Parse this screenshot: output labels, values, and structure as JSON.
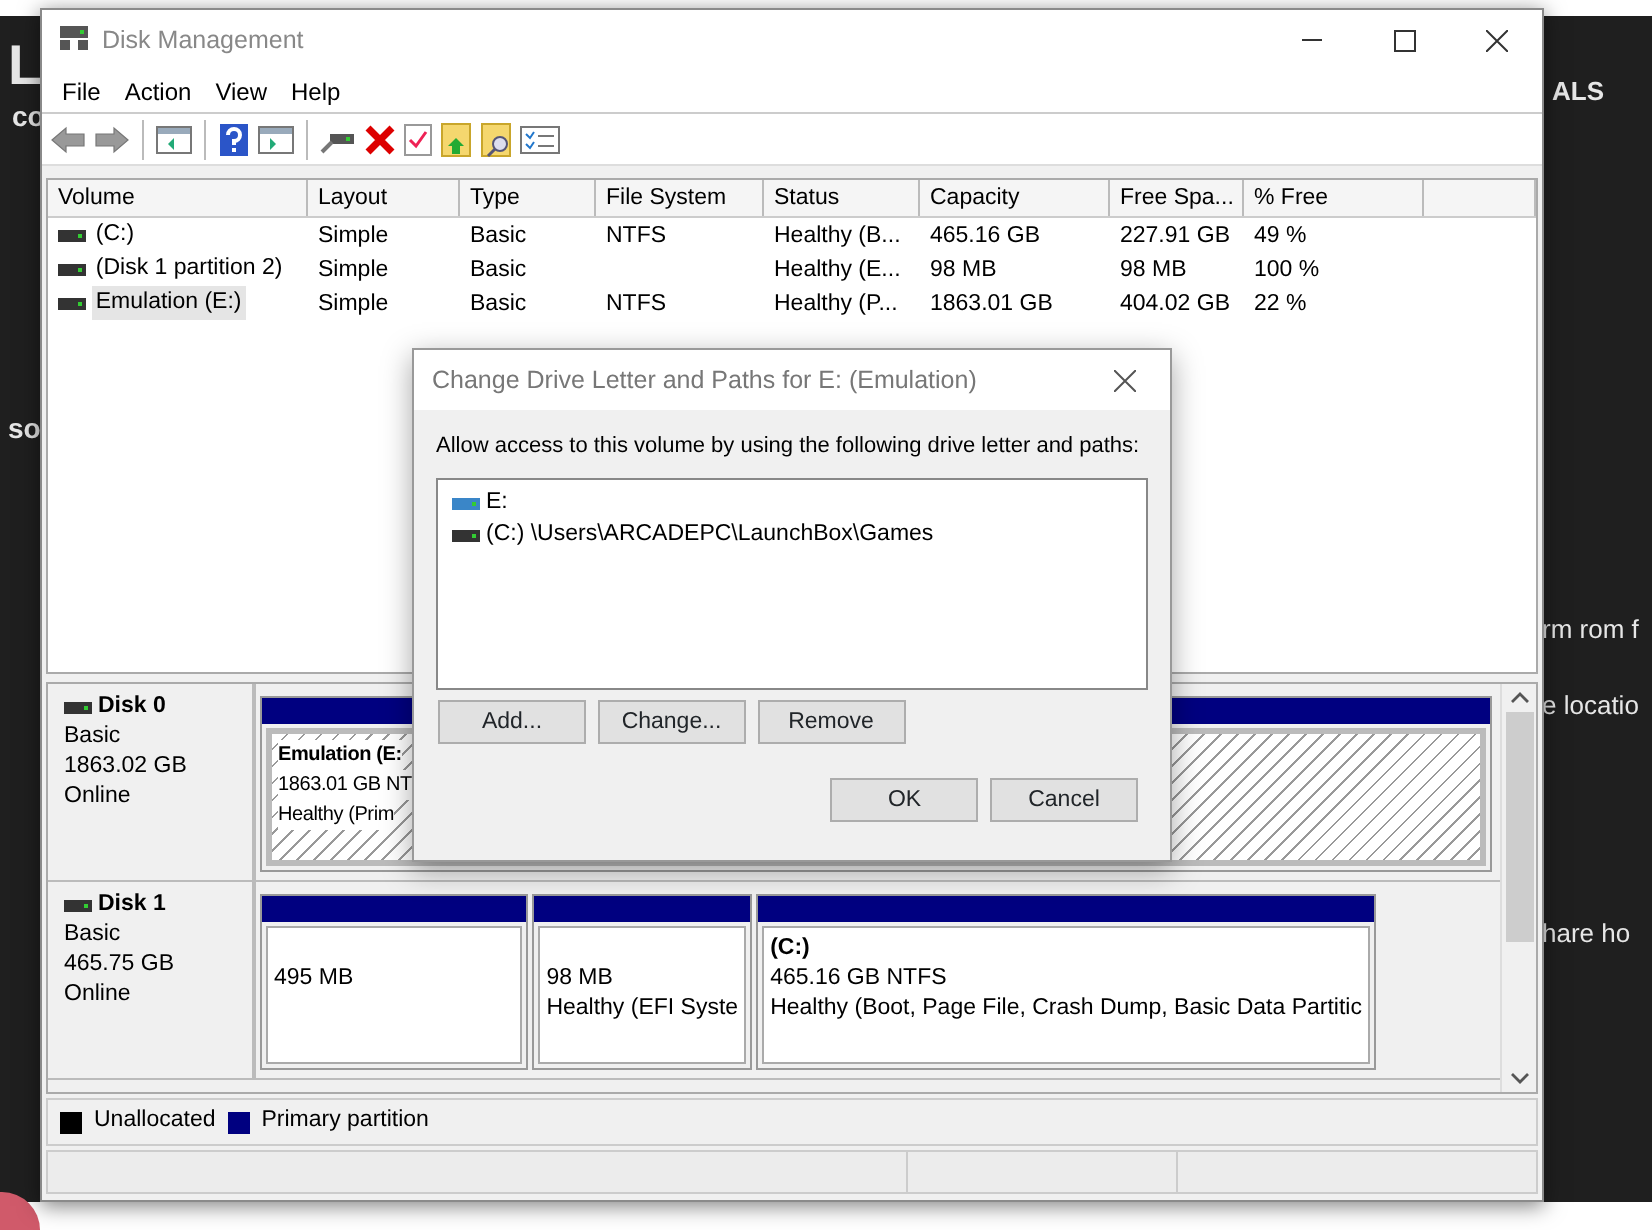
{
  "background": {
    "texts": [
      {
        "text": "L",
        "kind": "logo"
      },
      {
        "text": "co",
        "kind": "small"
      },
      {
        "text": "ALS",
        "kind": "nav"
      },
      {
        "text": "so",
        "kind": "small"
      },
      {
        "text": "rm rom f",
        "kind": "line"
      },
      {
        "text": "e locatio",
        "kind": "line"
      },
      {
        "text": "hare ho",
        "kind": "line"
      }
    ]
  },
  "window": {
    "title": "Disk Management"
  },
  "menu": [
    "File",
    "Action",
    "View",
    "Help"
  ],
  "toolbar": {
    "back_disabled": true,
    "forward_disabled": true
  },
  "volume_table": {
    "columns": [
      "Volume",
      "Layout",
      "Type",
      "File System",
      "Status",
      "Capacity",
      "Free Spa...",
      "% Free"
    ],
    "rows": [
      {
        "cells": [
          "(C:)",
          "Simple",
          "Basic",
          "NTFS",
          "Healthy (B...",
          "465.16 GB",
          "227.91 GB",
          "49 %"
        ],
        "selected": false
      },
      {
        "cells": [
          "(Disk 1 partition 2)",
          "Simple",
          "Basic",
          "",
          "Healthy (E...",
          "98 MB",
          "98 MB",
          "100 %"
        ],
        "selected": false
      },
      {
        "cells": [
          "Emulation (E:)",
          "Simple",
          "Basic",
          "NTFS",
          "Healthy (P...",
          "1863.01 GB",
          "404.02 GB",
          "22 %"
        ],
        "selected": true
      }
    ]
  },
  "disks": [
    {
      "name": "Disk 0",
      "type": "Basic",
      "size": "1863.02 GB",
      "status": "Online",
      "partitions": [
        {
          "title": "Emulation  (E:",
          "lines": [
            "1863.01 GB NT",
            "Healthy (Prim"
          ],
          "hatched": true
        }
      ]
    },
    {
      "name": "Disk 1",
      "type": "Basic",
      "size": "465.75 GB",
      "status": "Online",
      "partitions": [
        {
          "lines": [
            "495 MB"
          ],
          "hatched": false
        },
        {
          "lines": [
            "98 MB",
            "Healthy (EFI Syste"
          ],
          "hatched": false
        },
        {
          "title": "(C:)",
          "lines": [
            "465.16 GB NTFS",
            "Healthy (Boot, Page File, Crash Dump, Basic Data Partitic"
          ],
          "hatched": false
        }
      ]
    }
  ],
  "legend": [
    {
      "label": "Unallocated",
      "color": "#000000"
    },
    {
      "label": "Primary partition",
      "color": "#000080"
    }
  ],
  "dialog": {
    "title": "Change Drive Letter and Paths for E: (Emulation)",
    "prompt": "Allow access to this volume by using the following drive letter and paths:",
    "paths": [
      {
        "text": "E:",
        "kind": "letter"
      },
      {
        "text": "(C:) \\Users\\ARCADEPC\\LaunchBox\\Games",
        "kind": "folder"
      }
    ],
    "buttons": [
      "Add...",
      "Change...",
      "Remove"
    ],
    "footer_buttons": [
      "OK",
      "Cancel"
    ]
  }
}
